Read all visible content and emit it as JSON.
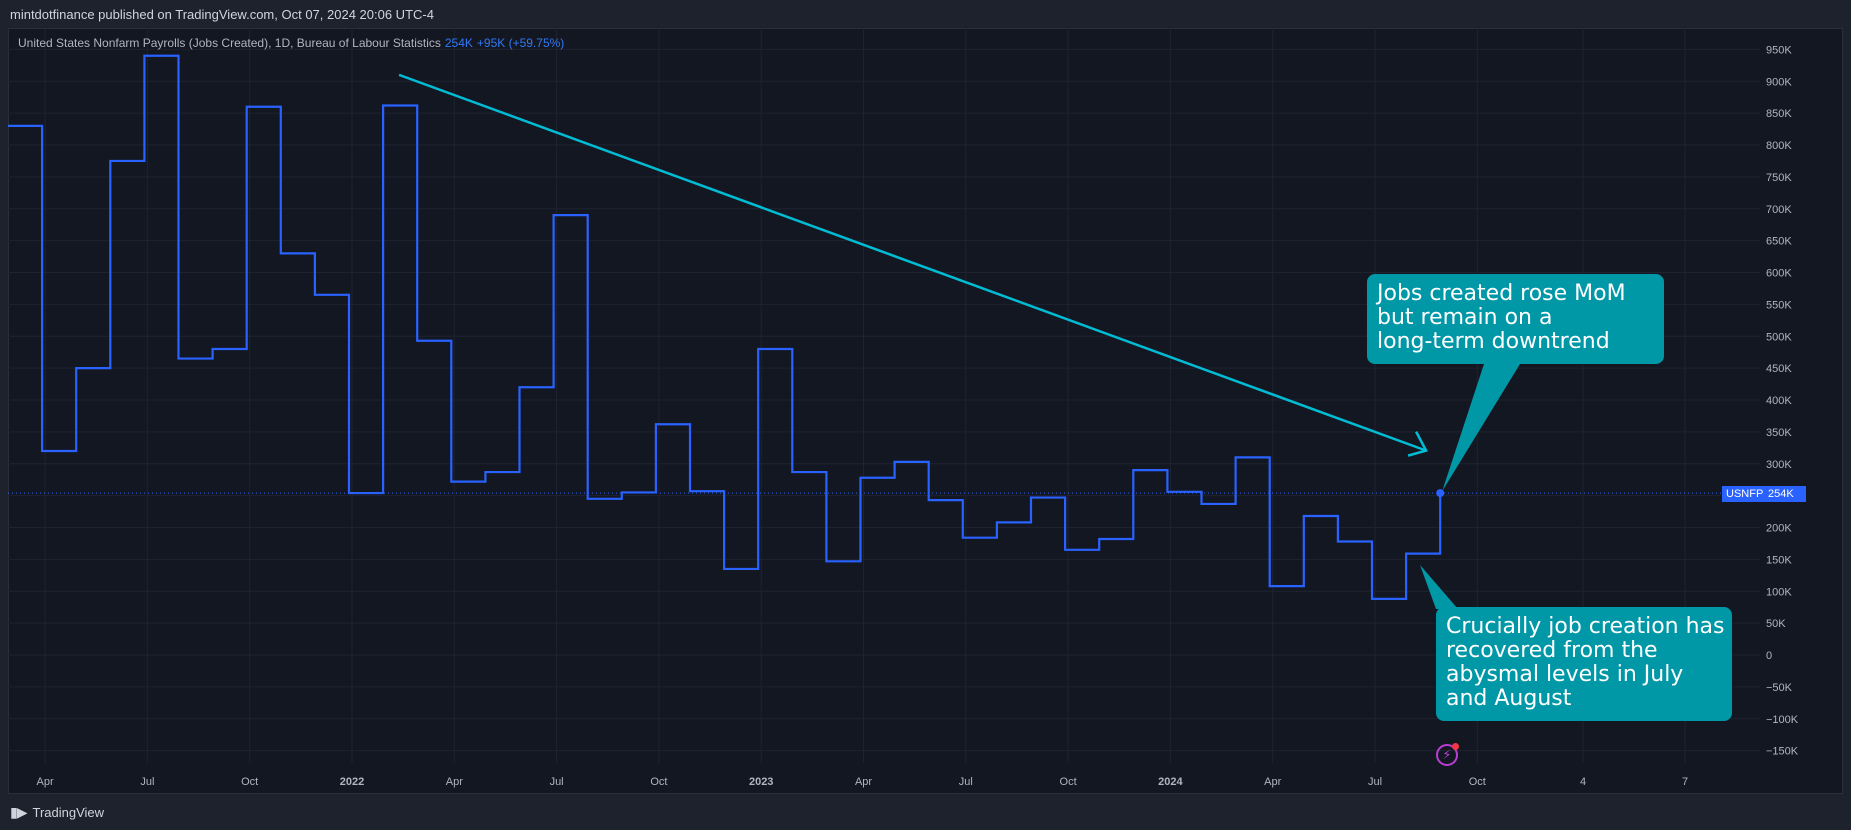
{
  "header": {
    "published_line": "mintdotfinance published on TradingView.com, Oct 07, 2024 20:06 UTC-4"
  },
  "legend": {
    "title": "United States Nonfarm Payrolls (Jobs Created), 1D, Bureau of Labour Statistics",
    "last_value": "254K",
    "change": "+95K (+59.75%)"
  },
  "price_tag": {
    "symbol": "USNFP",
    "value": "254K"
  },
  "annotations": {
    "callout_top": [
      "Jobs created rose MoM",
      "but remain on a",
      "long-term downtrend"
    ],
    "callout_bottom": [
      "Crucially job creation has",
      "recovered from the",
      "abysmal levels in July",
      "and August"
    ]
  },
  "footer": {
    "brand": "TradingView"
  },
  "colors": {
    "line": "#2962ff",
    "trend_arrow": "#00bcd4",
    "callout_bg": "#0097a7",
    "background": "#131722"
  },
  "chart_data": {
    "type": "line",
    "step": true,
    "title": "United States Nonfarm Payrolls (Jobs Created), 1D, Bureau of Labour Statistics",
    "xlabel": "",
    "ylabel": "",
    "x": [
      "2021-03",
      "2021-04",
      "2021-05",
      "2021-06",
      "2021-07",
      "2021-08",
      "2021-09",
      "2021-10",
      "2021-11",
      "2021-12",
      "2022-01",
      "2022-02",
      "2022-03",
      "2022-04",
      "2022-05",
      "2022-06",
      "2022-07",
      "2022-08",
      "2022-09",
      "2022-10",
      "2022-11",
      "2022-12",
      "2023-01",
      "2023-02",
      "2023-03",
      "2023-04",
      "2023-05",
      "2023-06",
      "2023-07",
      "2023-08",
      "2023-09",
      "2023-10",
      "2023-11",
      "2023-12",
      "2024-01",
      "2024-02",
      "2024-03",
      "2024-04",
      "2024-05",
      "2024-06",
      "2024-07",
      "2024-08",
      "2024-09"
    ],
    "series": [
      {
        "values": [
          830,
          320,
          450,
          775,
          940,
          465,
          480,
          860,
          630,
          565,
          254,
          862,
          493,
          272,
          287,
          420,
          690,
          245,
          255,
          362,
          257,
          135,
          480,
          287,
          147,
          278,
          303,
          243,
          184,
          208,
          247,
          165,
          182,
          290,
          256,
          237,
          310,
          108,
          218,
          178,
          88,
          159,
          254
        ]
      }
    ],
    "ylim": [
      -175,
      975
    ],
    "y_ticks": [
      "950K",
      "900K",
      "850K",
      "800K",
      "750K",
      "700K",
      "650K",
      "600K",
      "550K",
      "500K",
      "450K",
      "400K",
      "350K",
      "300K",
      "250K",
      "200K",
      "150K",
      "100K",
      "50K",
      "0",
      "−50K",
      "−100K",
      "−150K"
    ],
    "x_ticks": [
      "Apr",
      "Jul",
      "Oct",
      "2022",
      "Apr",
      "Jul",
      "Oct",
      "2023",
      "Apr",
      "Jul",
      "Oct",
      "2024",
      "Apr",
      "Jul",
      "Oct",
      "4",
      "7"
    ],
    "last_value_line": 254,
    "trend_arrow": {
      "from": [
        "2022-02",
        910
      ],
      "to": [
        "2024-08",
        330
      ]
    },
    "grid": true,
    "legend_placement": "top-left"
  }
}
